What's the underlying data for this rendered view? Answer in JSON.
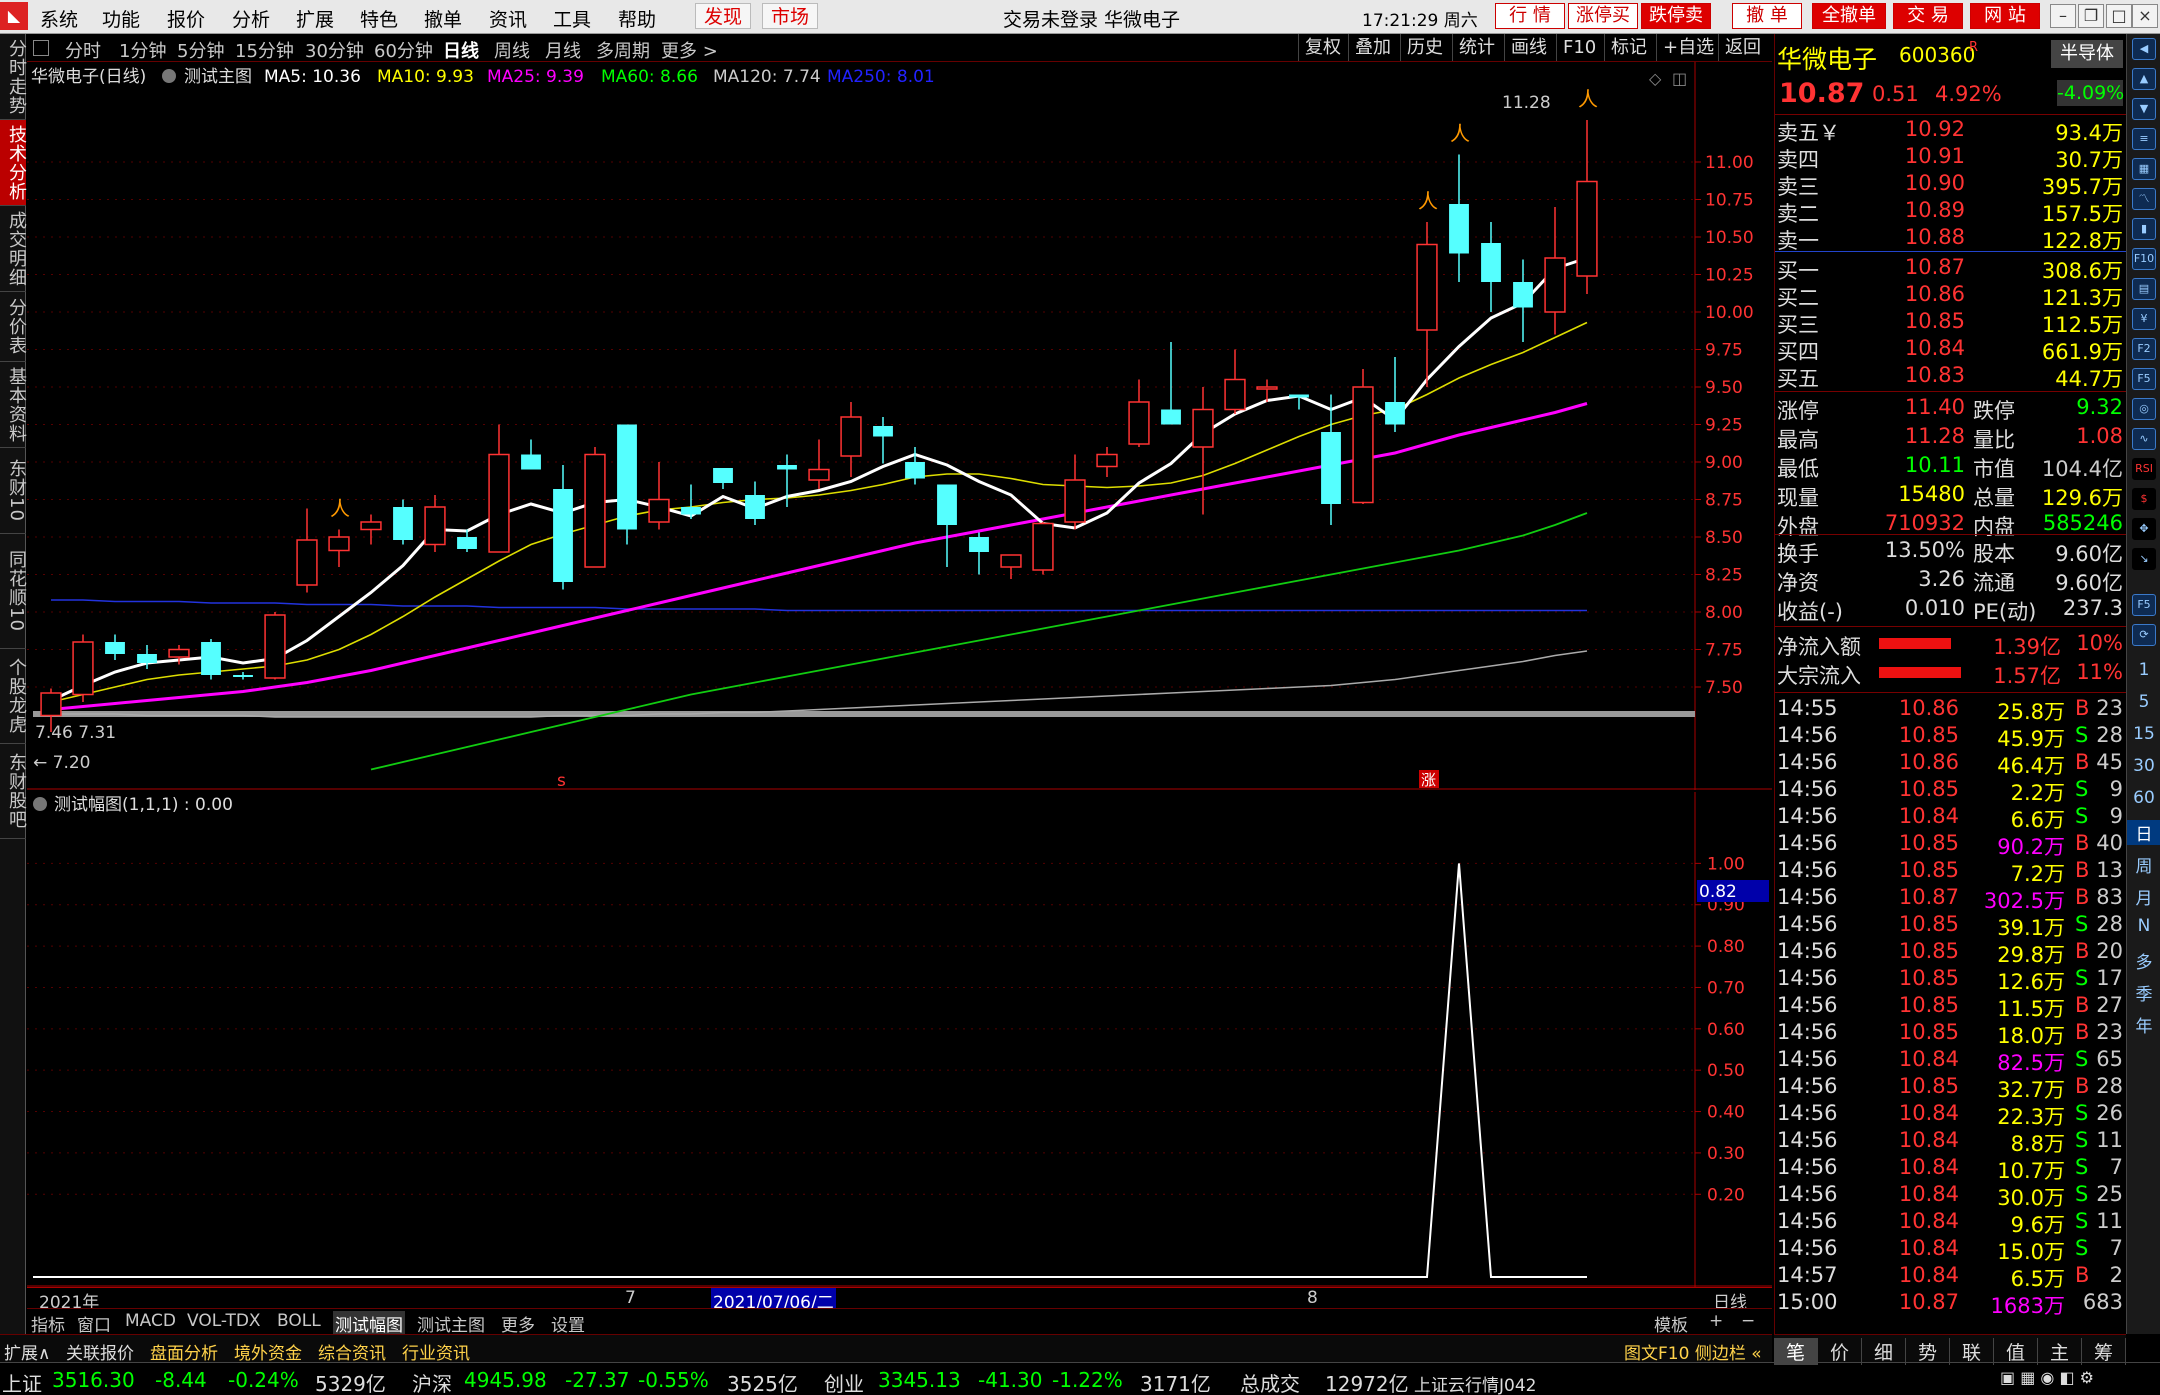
{
  "menu": {
    "items": [
      "系统",
      "功能",
      "报价",
      "分析",
      "扩展",
      "特色",
      "撤单",
      "资讯",
      "工具",
      "帮助"
    ],
    "discover": "发现",
    "market": "市场",
    "title": "交易未登录  华微电子",
    "clock": "17:21:29 周六",
    "right_buttons": [
      "行  情",
      "涨停买",
      "跌停卖",
      "撤  单",
      "全撤单",
      "交  易",
      "网  站"
    ]
  },
  "left_tabs": [
    "分时走势",
    "技术分析",
    "成交明细",
    "分价表",
    "基本资料",
    "东财10",
    "同花顺10",
    "个股龙虎",
    "东财股吧"
  ],
  "periods": [
    "分时",
    "1分钟",
    "5分钟",
    "15分钟",
    "30分钟",
    "60分钟",
    "日线",
    "周线",
    "月线",
    "多周期",
    "更多 >"
  ],
  "tools": [
    "复权",
    "叠加",
    "历史",
    "统计",
    "画线",
    "F10",
    "标记",
    "+自选",
    "返回"
  ],
  "legend": {
    "name": "华微电子(日线)",
    "formula": "测试主图",
    "ma5": "MA5: 10.36",
    "ma10": "MA10: 9.93",
    "ma25": "MA25: 9.39",
    "ma60": "MA60: 8.66",
    "ma120": "MA120: 7.74",
    "ma250": "MA250: 8.01"
  },
  "sub_legend": "测试幅图(1,1,1) : 0.00",
  "chart_labels": {
    "high": "11.28",
    "low_left": "7.46  7.31",
    "low_mark": "← 7.20",
    "axis_2021": "2021年",
    "axis_7": "7",
    "axis_date": "2021/07/06/二",
    "axis_8": "8",
    "bottom_right": "日线",
    "sub_current": "0.82",
    "mark_s": "s",
    "mark_zhang": "涨"
  },
  "chart_data": [
    {
      "type": "candlestick",
      "ylim": [
        7.2,
        11.4
      ],
      "yticks": [
        "11.00",
        "10.75",
        "10.50",
        "10.25",
        "10.00",
        "9.75",
        "9.50",
        "9.25",
        "9.00",
        "8.75",
        "8.50",
        "8.25",
        "8.00",
        "7.75",
        "7.50"
      ],
      "ohlc": [
        [
          7.31,
          7.49,
          7.2,
          7.46
        ],
        [
          7.45,
          7.85,
          7.4,
          7.8
        ],
        [
          7.8,
          7.85,
          7.68,
          7.72
        ],
        [
          7.72,
          7.78,
          7.62,
          7.66
        ],
        [
          7.7,
          7.78,
          7.65,
          7.75
        ],
        [
          7.8,
          7.82,
          7.55,
          7.58
        ],
        [
          7.58,
          7.6,
          7.55,
          7.57
        ],
        [
          7.56,
          8.0,
          7.55,
          7.98
        ],
        [
          8.18,
          8.69,
          8.13,
          8.48
        ],
        [
          8.41,
          8.55,
          8.3,
          8.5
        ],
        [
          8.55,
          8.65,
          8.45,
          8.6
        ],
        [
          8.7,
          8.75,
          8.45,
          8.48
        ],
        [
          8.45,
          8.78,
          8.4,
          8.7
        ],
        [
          8.5,
          8.55,
          8.4,
          8.42
        ],
        [
          8.4,
          9.25,
          8.4,
          9.05
        ],
        [
          9.05,
          9.15,
          8.95,
          8.95
        ],
        [
          8.82,
          8.98,
          8.15,
          8.2
        ],
        [
          8.3,
          9.1,
          8.3,
          9.05
        ],
        [
          9.25,
          9.25,
          8.45,
          8.55
        ],
        [
          8.6,
          9.0,
          8.55,
          8.75
        ],
        [
          8.7,
          8.85,
          8.62,
          8.65
        ],
        [
          8.96,
          8.96,
          8.82,
          8.86
        ],
        [
          8.78,
          8.87,
          8.58,
          8.62
        ],
        [
          8.98,
          9.05,
          8.7,
          8.95
        ],
        [
          8.88,
          9.15,
          8.82,
          8.95
        ],
        [
          9.04,
          9.4,
          8.9,
          9.3
        ],
        [
          9.24,
          9.3,
          8.99,
          9.17
        ],
        [
          9.0,
          9.1,
          8.85,
          8.89
        ],
        [
          8.85,
          8.85,
          8.3,
          8.58
        ],
        [
          8.5,
          8.53,
          8.25,
          8.4
        ],
        [
          8.3,
          8.35,
          8.22,
          8.38
        ],
        [
          8.28,
          8.6,
          8.25,
          8.59
        ],
        [
          8.6,
          9.05,
          8.55,
          8.88
        ],
        [
          8.97,
          9.1,
          8.9,
          9.05
        ],
        [
          9.12,
          9.55,
          9.1,
          9.4
        ],
        [
          9.35,
          9.8,
          9.3,
          9.25
        ],
        [
          9.1,
          9.5,
          8.65,
          9.35
        ],
        [
          9.35,
          9.75,
          9.32,
          9.55
        ],
        [
          9.5,
          9.55,
          9.4,
          9.5
        ],
        [
          9.45,
          9.45,
          9.35,
          9.43
        ],
        [
          9.2,
          9.45,
          8.58,
          8.72
        ],
        [
          8.73,
          9.62,
          8.72,
          9.5
        ],
        [
          9.4,
          9.7,
          9.2,
          9.25
        ],
        [
          9.88,
          10.6,
          9.5,
          10.45
        ],
        [
          10.72,
          11.05,
          10.2,
          10.39
        ],
        [
          10.46,
          10.6,
          10.0,
          10.2
        ],
        [
          10.2,
          10.35,
          9.8,
          10.03
        ],
        [
          10.0,
          10.7,
          9.85,
          10.36
        ],
        [
          10.24,
          11.28,
          10.12,
          10.87
        ]
      ],
      "ma5": [
        7.41,
        7.51,
        7.6,
        7.66,
        7.68,
        7.7,
        7.66,
        7.69,
        7.81,
        7.97,
        8.13,
        8.31,
        8.55,
        8.54,
        8.65,
        8.72,
        8.66,
        8.73,
        8.75,
        8.7,
        8.64,
        8.77,
        8.69,
        8.77,
        8.81,
        8.87,
        8.97,
        9.05,
        8.98,
        8.87,
        8.78,
        8.59,
        8.56,
        8.66,
        8.86,
        8.99,
        9.19,
        9.32,
        9.41,
        9.44,
        9.35,
        9.43,
        9.28,
        9.55,
        9.77,
        9.96,
        10.06,
        10.29,
        10.36
      ],
      "ma10": [
        7.4,
        7.45,
        7.5,
        7.55,
        7.58,
        7.6,
        7.62,
        7.64,
        7.68,
        7.75,
        7.85,
        7.97,
        8.1,
        8.22,
        8.34,
        8.45,
        8.52,
        8.58,
        8.64,
        8.68,
        8.7,
        8.73,
        8.75,
        8.76,
        8.78,
        8.81,
        8.85,
        8.9,
        8.92,
        8.92,
        8.89,
        8.85,
        8.84,
        8.83,
        8.84,
        8.86,
        8.91,
        8.99,
        9.08,
        9.17,
        9.25,
        9.31,
        9.35,
        9.45,
        9.56,
        9.65,
        9.73,
        9.83,
        9.93
      ],
      "ma25": [
        7.35,
        7.37,
        7.39,
        7.41,
        7.43,
        7.45,
        7.47,
        7.5,
        7.53,
        7.57,
        7.61,
        7.66,
        7.71,
        7.76,
        7.81,
        7.86,
        7.91,
        7.96,
        8.01,
        8.06,
        8.11,
        8.16,
        8.21,
        8.26,
        8.31,
        8.36,
        8.41,
        8.46,
        8.5,
        8.54,
        8.58,
        8.62,
        8.66,
        8.7,
        8.74,
        8.78,
        8.82,
        8.86,
        8.9,
        8.94,
        8.98,
        9.02,
        9.06,
        9.12,
        9.18,
        9.23,
        9.28,
        9.33,
        9.39
      ],
      "ma60": [
        null,
        null,
        null,
        null,
        null,
        null,
        null,
        null,
        null,
        null,
        6.95,
        7.0,
        7.05,
        7.1,
        7.15,
        7.2,
        7.25,
        7.3,
        7.35,
        7.4,
        7.45,
        7.49,
        7.53,
        7.57,
        7.61,
        7.65,
        7.69,
        7.73,
        7.77,
        7.81,
        7.85,
        7.89,
        7.93,
        7.97,
        8.01,
        8.05,
        8.09,
        8.13,
        8.17,
        8.21,
        8.25,
        8.29,
        8.33,
        8.37,
        8.41,
        8.46,
        8.51,
        8.58,
        8.66
      ],
      "ma120": [
        7.32,
        7.32,
        7.32,
        7.31,
        7.31,
        7.31,
        7.31,
        7.3,
        7.3,
        7.3,
        7.3,
        7.3,
        7.3,
        7.3,
        7.3,
        7.3,
        7.31,
        7.31,
        7.31,
        7.32,
        7.32,
        7.33,
        7.33,
        7.34,
        7.35,
        7.36,
        7.37,
        7.38,
        7.39,
        7.4,
        7.41,
        7.42,
        7.43,
        7.44,
        7.45,
        7.46,
        7.47,
        7.48,
        7.49,
        7.5,
        7.51,
        7.53,
        7.55,
        7.58,
        7.61,
        7.64,
        7.67,
        7.71,
        7.74
      ],
      "ma250": [
        8.08,
        8.08,
        8.07,
        8.07,
        8.07,
        8.06,
        8.06,
        8.06,
        8.05,
        8.05,
        8.05,
        8.04,
        8.04,
        8.04,
        8.03,
        8.03,
        8.03,
        8.03,
        8.02,
        8.02,
        8.02,
        8.02,
        8.02,
        8.01,
        8.01,
        8.01,
        8.01,
        8.01,
        8.01,
        8.01,
        8.01,
        8.01,
        8.01,
        8.01,
        8.01,
        8.01,
        8.01,
        8.01,
        8.01,
        8.01,
        8.01,
        8.01,
        8.01,
        8.01,
        8.01,
        8.01,
        8.01,
        8.01,
        8.01
      ],
      "markers": [
        9,
        43,
        44,
        48
      ]
    },
    {
      "type": "line",
      "name": "测试幅图",
      "ylim": [
        0,
        1.1
      ],
      "yticks": [
        "1.00",
        "0.90",
        "0.80",
        "0.70",
        "0.60",
        "0.50",
        "0.40",
        "0.30",
        "0.20"
      ],
      "values": [
        0,
        0,
        0,
        0,
        0,
        0,
        0,
        0,
        0,
        0,
        0,
        0,
        0,
        0,
        0,
        0,
        0,
        0,
        0,
        0,
        0,
        0,
        0,
        0,
        0,
        0,
        0,
        0,
        0,
        0,
        0,
        0,
        0,
        0,
        0,
        0,
        0,
        0,
        0,
        0,
        0,
        0,
        0,
        0,
        1,
        0,
        0,
        0,
        0
      ],
      "start_index": 0
    }
  ],
  "indicator_tabs": [
    "指标",
    "窗口",
    "MACD",
    "VOL-TDX",
    "BOLL",
    "测试幅图",
    "测试主图",
    "更多",
    "设置"
  ],
  "indicator_right": [
    "模板",
    "+",
    "−"
  ],
  "ext_bar": [
    "扩展∧",
    "关联报价",
    "盘面分析",
    "境外资金",
    "综合资讯",
    "行业资讯"
  ],
  "ext_right": "图文F10 侧边栏 «",
  "status": {
    "sh_name": "上证",
    "sh_value": "3516.30",
    "sh_change": "-8.44",
    "sh_pct": "-0.24%",
    "sh_amount": "5329亿",
    "hs_name": "沪深",
    "hs_value": "4945.98",
    "hs_change": "-27.37",
    "hs_pct": "-0.55%",
    "hs_amount": "3525亿",
    "cy_name": "创业",
    "cy_value": "3345.13",
    "cy_change": "-41.30",
    "cy_pct": "-1.22%",
    "cy_amount": "3171亿",
    "total_label": "总成交",
    "total_value": "12972亿",
    "server": "上证云行情J042"
  },
  "quote": {
    "name": "华微电子",
    "code": "600360",
    "r": "R",
    "halfscreen": "半导体",
    "price": "10.87",
    "change": "0.51",
    "pct": "4.92%",
    "sector_pct": "-4.09%",
    "asks": [
      [
        "卖五￥",
        "10.92",
        "93.4万"
      ],
      [
        "卖四",
        "10.91",
        "30.7万"
      ],
      [
        "卖三",
        "10.90",
        "395.7万"
      ],
      [
        "卖二",
        "10.89",
        "157.5万"
      ],
      [
        "卖一",
        "10.88",
        "122.8万"
      ]
    ],
    "bids": [
      [
        "买一",
        "10.87",
        "308.6万"
      ],
      [
        "买二",
        "10.86",
        "121.3万"
      ],
      [
        "买三",
        "10.85",
        "112.5万"
      ],
      [
        "买四",
        "10.84",
        "661.9万"
      ],
      [
        "买五",
        "10.83",
        "44.7万"
      ]
    ],
    "stats": [
      [
        "涨停",
        "11.40",
        "跌停",
        "9.32"
      ],
      [
        "最高",
        "11.28",
        "量比",
        "1.08"
      ],
      [
        "最低",
        "10.11",
        "市值",
        "104.4亿"
      ],
      [
        "现量",
        "15480",
        "总量",
        "129.6万"
      ],
      [
        "外盘",
        "710932",
        "内盘",
        "585246"
      ]
    ],
    "stats2": [
      [
        "换手",
        "13.50%",
        "股本",
        "9.60亿"
      ],
      [
        "净资",
        "3.26",
        "流通",
        "9.60亿"
      ],
      [
        "收益(-)",
        "0.010",
        "PE(动)",
        "237.3"
      ]
    ],
    "flow": [
      [
        "净流入额",
        "1.39亿",
        "10%"
      ],
      [
        "大宗流入",
        "1.57亿",
        "11%"
      ]
    ],
    "ticks": [
      [
        "14:55",
        "10.86",
        "25.8万",
        "B",
        "23"
      ],
      [
        "14:56",
        "10.85",
        "45.9万",
        "S",
        "28"
      ],
      [
        "14:56",
        "10.86",
        "46.4万",
        "B",
        "45"
      ],
      [
        "14:56",
        "10.85",
        "2.2万",
        "S",
        "9"
      ],
      [
        "14:56",
        "10.84",
        "6.6万",
        "S",
        "9"
      ],
      [
        "14:56",
        "10.85",
        "90.2万",
        "B",
        "40"
      ],
      [
        "14:56",
        "10.85",
        "7.2万",
        "B",
        "13"
      ],
      [
        "14:56",
        "10.87",
        "302.5万",
        "B",
        "83"
      ],
      [
        "14:56",
        "10.85",
        "39.1万",
        "S",
        "28"
      ],
      [
        "14:56",
        "10.85",
        "29.8万",
        "B",
        "20"
      ],
      [
        "14:56",
        "10.85",
        "12.6万",
        "S",
        "17"
      ],
      [
        "14:56",
        "10.85",
        "11.5万",
        "B",
        "27"
      ],
      [
        "14:56",
        "10.85",
        "18.0万",
        "B",
        "23"
      ],
      [
        "14:56",
        "10.84",
        "82.5万",
        "S",
        "65"
      ],
      [
        "14:56",
        "10.85",
        "32.7万",
        "B",
        "28"
      ],
      [
        "14:56",
        "10.84",
        "22.3万",
        "S",
        "26"
      ],
      [
        "14:56",
        "10.84",
        "8.8万",
        "S",
        "11"
      ],
      [
        "14:56",
        "10.84",
        "10.7万",
        "S",
        "7"
      ],
      [
        "14:56",
        "10.84",
        "30.0万",
        "S",
        "25"
      ],
      [
        "14:56",
        "10.84",
        "9.6万",
        "S",
        "11"
      ],
      [
        "14:56",
        "10.84",
        "15.0万",
        "S",
        "7"
      ],
      [
        "14:57",
        "10.84",
        "6.5万",
        "B",
        "2"
      ],
      [
        "15:00",
        "10.87",
        "1683万",
        "",
        "683"
      ]
    ]
  },
  "right_tabs": [
    "笔",
    "价",
    "细",
    "势",
    "联",
    "值",
    "主",
    "筹"
  ],
  "right_icons": [
    "up-icon",
    "down-icon",
    "list-icon",
    "grid-icon",
    "chart-icon",
    "candle-icon",
    "f10-icon",
    "news-icon",
    "money-icon",
    "f2-icon",
    "f5-icon",
    "rsi-icon",
    "dollar-icon",
    "move-icon",
    "arrow-icon",
    "f5b-icon",
    "refresh-icon"
  ],
  "right_periods": [
    "1",
    "5",
    "15",
    "30",
    "60",
    "日",
    "周",
    "月",
    "N",
    "多",
    "季",
    "年"
  ]
}
